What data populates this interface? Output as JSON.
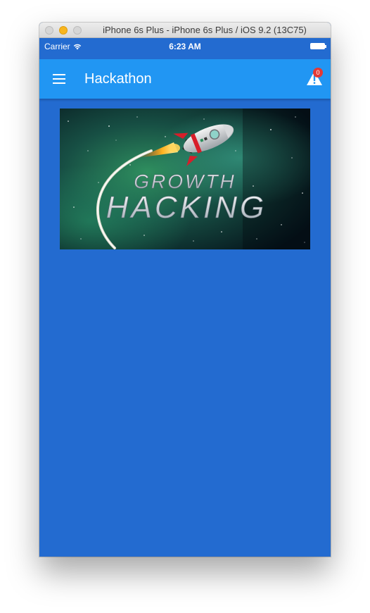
{
  "window": {
    "title": "iPhone 6s Plus - iPhone 6s Plus / iOS 9.2 (13C75)"
  },
  "status_bar": {
    "carrier": "Carrier",
    "time": "6:23 AM"
  },
  "app_bar": {
    "title": "Hackathon",
    "menu_icon": "hamburger-menu-icon",
    "alert_icon": "warning-icon",
    "alert_badge": "0"
  },
  "banner": {
    "line1": "GROWTH",
    "line2": "HACKING"
  },
  "colors": {
    "background": "#236bd0",
    "app_bar": "#2196f3",
    "badge": "#e53935"
  }
}
